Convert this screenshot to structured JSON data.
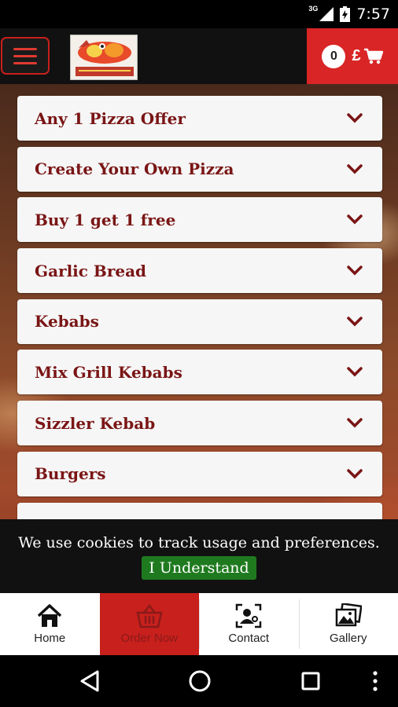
{
  "status_bar": {
    "network": "3G",
    "time": "7:57"
  },
  "header": {
    "logo_alt": "Quality, Value, Service",
    "cart": {
      "count": "0",
      "currency": "£"
    }
  },
  "categories": [
    {
      "label": "Any 1 Pizza Offer"
    },
    {
      "label": "Create Your Own Pizza"
    },
    {
      "label": "Buy 1 get 1 free"
    },
    {
      "label": "Garlic Bread"
    },
    {
      "label": "Kebabs"
    },
    {
      "label": "Mix Grill Kebabs"
    },
    {
      "label": "Sizzler Kebab"
    },
    {
      "label": "Burgers"
    }
  ],
  "cookie_banner": {
    "text": "We use cookies to track usage and preferences.",
    "accept_label": "I Understand"
  },
  "bottom_nav": [
    {
      "label": "Home",
      "icon": "home-icon"
    },
    {
      "label": "Order Now",
      "icon": "basket-icon"
    },
    {
      "label": "Contact",
      "icon": "contact-icon"
    },
    {
      "label": "Gallery",
      "icon": "gallery-icon"
    }
  ],
  "colors": {
    "brand_red": "#d92525",
    "label_red": "#7a1515",
    "accept_green": "#1f7a1f"
  }
}
